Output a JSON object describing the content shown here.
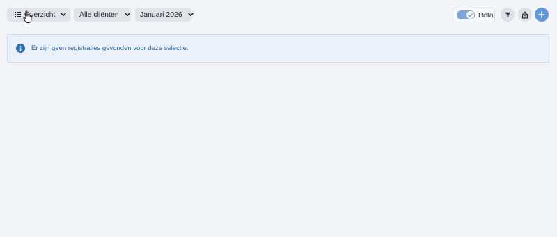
{
  "toolbar": {
    "view_select": {
      "label": "Overzicht",
      "icon": "list-icon"
    },
    "client_select": {
      "label": "Alle cliënten"
    },
    "period_select": {
      "label": "Januari 2026"
    },
    "beta_toggle": {
      "label": "Beta",
      "checked": true
    },
    "filter_button": {
      "icon": "filter-icon"
    },
    "share_button": {
      "icon": "share-icon"
    },
    "add_button": {
      "icon": "plus-icon"
    }
  },
  "alert": {
    "icon": "info-icon",
    "message": "Er zijn geen registraties gevonden voor deze selectie."
  },
  "colors": {
    "background": "#f3f4f7",
    "accent": "#5d97de",
    "alert_text": "#3168a6",
    "alert_background": "#eaf1fb"
  }
}
